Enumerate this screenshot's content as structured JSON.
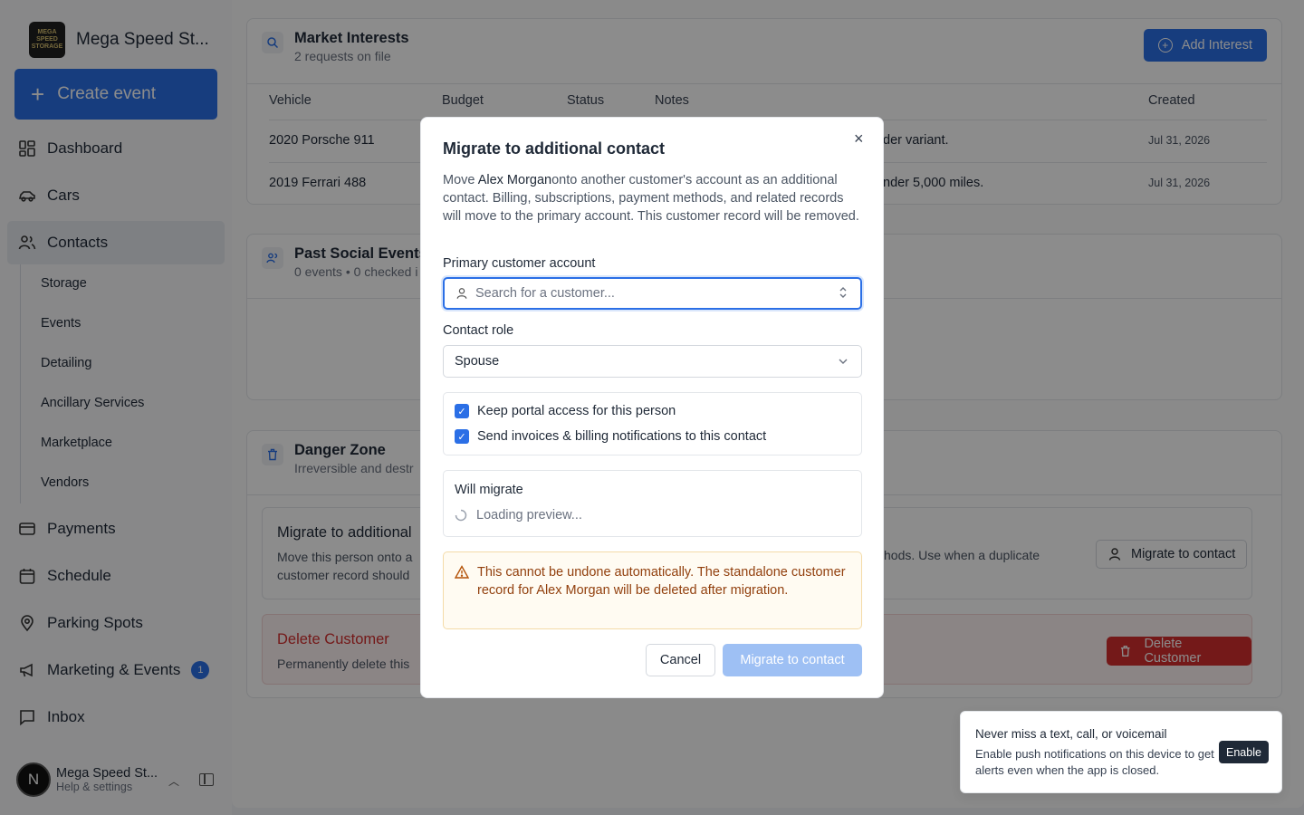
{
  "app": {
    "brand_name": "Mega Speed St...",
    "brand_logo_text": "MEGA SPEED STORAGE",
    "create_event_label": "Create event"
  },
  "sidebar": {
    "items": [
      {
        "label": "Dashboard",
        "icon": "dashboard-icon"
      },
      {
        "label": "Cars",
        "icon": "car-icon"
      },
      {
        "label": "Contacts",
        "icon": "users-icon",
        "active": true
      },
      {
        "label": "Payments",
        "icon": "credit-card-icon"
      },
      {
        "label": "Schedule",
        "icon": "calendar-icon"
      },
      {
        "label": "Parking Spots",
        "icon": "map-pin-icon"
      },
      {
        "label": "Marketing & Events",
        "icon": "megaphone-icon",
        "badge": "1"
      },
      {
        "label": "Inbox",
        "icon": "message-icon"
      }
    ],
    "subitems": [
      "Storage",
      "Events",
      "Detailing",
      "Ancillary Services",
      "Marketplace",
      "Vendors"
    ],
    "user": {
      "initial": "N",
      "name": "Mega Speed St...",
      "subtitle": "Help & settings"
    }
  },
  "market_interests": {
    "title": "Market Interests",
    "subtitle": "2 requests on file",
    "add_label": "Add Interest",
    "columns": [
      "Vehicle",
      "Budget",
      "Status",
      "Notes",
      "Created"
    ],
    "rows": [
      {
        "vehicle": "2020 Porsche 911",
        "notes": "der variant.",
        "created": "Jul 31, 2026"
      },
      {
        "vehicle": "2019 Ferrari 488",
        "notes": "nder 5,000 miles.",
        "created": "Jul 31, 2026"
      }
    ]
  },
  "past_events": {
    "title": "Past Social Events",
    "subtitle": "0 events • 0 checked i"
  },
  "danger_zone": {
    "title": "Danger Zone",
    "subtitle": "Irreversible and destr",
    "migrate": {
      "title": "Migrate to additional",
      "desc_line1": "Move this person onto a",
      "desc_line2": "customer record should",
      "desc_right": "hods. Use when a duplicate",
      "button": "Migrate to contact"
    },
    "delete": {
      "title": "Delete Customer",
      "desc": "Permanently delete this",
      "button": "Delete Customer"
    }
  },
  "modal": {
    "title": "Migrate to additional contact",
    "close": "×",
    "desc_prefix": "Move ",
    "desc_name": "Alex Morgan",
    "desc_rest": "onto another customer's account as an additional contact. Billing, subscriptions, payment methods, and related records will move to the primary account. This customer record will be removed.",
    "primary_label": "Primary customer account",
    "primary_placeholder": "Search for a customer...",
    "role_label": "Contact role",
    "role_value": "Spouse",
    "checks": [
      {
        "label": "Keep portal access for this person",
        "checked": true
      },
      {
        "label": "Send invoices & billing notifications to this contact",
        "checked": true
      }
    ],
    "will_migrate_label": "Will migrate",
    "loading_text": "Loading preview...",
    "warning": "This cannot be undone automatically. The standalone customer record for Alex Morgan will be deleted after migration.",
    "cancel": "Cancel",
    "confirm": "Migrate to contact"
  },
  "toast": {
    "title": "Never miss a text, call, or voicemail",
    "body": "Enable push notifications on this device to get alerts even when the app is closed.",
    "button": "Enable"
  },
  "colors": {
    "accent": "#2b6fe6",
    "danger": "#d32f2f",
    "warning_text": "#92400e"
  }
}
